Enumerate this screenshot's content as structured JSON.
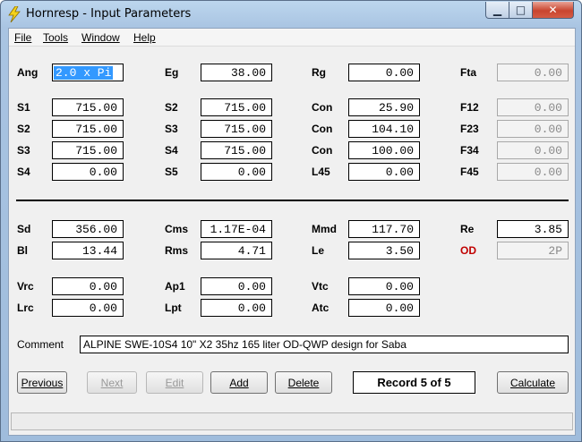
{
  "window": {
    "title": "Hornresp - Input Parameters"
  },
  "menu": [
    "File",
    "Tools",
    "Window",
    "Help"
  ],
  "rows1": [
    [
      {
        "label": "Ang",
        "value": "2.0 x Pi",
        "selected": true
      },
      {
        "label": "Eg",
        "value": "38.00"
      },
      {
        "label": "Rg",
        "value": "0.00"
      },
      {
        "label": "Fta",
        "value": "0.00",
        "disabled": true
      }
    ],
    [
      {
        "label": "S1",
        "value": "715.00"
      },
      {
        "label": "S2",
        "value": "715.00"
      },
      {
        "label": "Con",
        "value": "25.90"
      },
      {
        "label": "F12",
        "value": "0.00",
        "disabled": true
      }
    ],
    [
      {
        "label": "S2",
        "value": "715.00"
      },
      {
        "label": "S3",
        "value": "715.00"
      },
      {
        "label": "Con",
        "value": "104.10"
      },
      {
        "label": "F23",
        "value": "0.00",
        "disabled": true
      }
    ],
    [
      {
        "label": "S3",
        "value": "715.00"
      },
      {
        "label": "S4",
        "value": "715.00"
      },
      {
        "label": "Con",
        "value": "100.00"
      },
      {
        "label": "F34",
        "value": "0.00",
        "disabled": true
      }
    ],
    [
      {
        "label": "S4",
        "value": "0.00"
      },
      {
        "label": "S5",
        "value": "0.00"
      },
      {
        "label": "L45",
        "value": "0.00"
      },
      {
        "label": "F45",
        "value": "0.00",
        "disabled": true
      }
    ]
  ],
  "rows2": [
    [
      {
        "label": "Sd",
        "value": "356.00"
      },
      {
        "label": "Cms",
        "value": "1.17E-04"
      },
      {
        "label": "Mmd",
        "value": "117.70"
      },
      {
        "label": "Re",
        "value": "3.85"
      }
    ],
    [
      {
        "label": "Bl",
        "value": "13.44"
      },
      {
        "label": "Rms",
        "value": "4.71"
      },
      {
        "label": "Le",
        "value": "3.50"
      },
      {
        "label": "OD",
        "value": "2P",
        "red": true,
        "disabled": true
      }
    ],
    [
      {
        "label": "Vrc",
        "value": "0.00"
      },
      {
        "label": "Ap1",
        "value": "0.00"
      },
      {
        "label": "Vtc",
        "value": "0.00"
      }
    ],
    [
      {
        "label": "Lrc",
        "value": "0.00"
      },
      {
        "label": "Lpt",
        "value": "0.00"
      },
      {
        "label": "Atc",
        "value": "0.00"
      }
    ]
  ],
  "comment": {
    "label": "Comment",
    "value": "ALPINE SWE-10S4 10\" X2 35hz 165 liter OD-QWP design for Saba"
  },
  "buttons": [
    {
      "label": "Previous",
      "disabled": false
    },
    {
      "label": "Next",
      "disabled": true
    },
    {
      "label": "Edit",
      "disabled": true
    },
    {
      "label": "Add",
      "disabled": false
    },
    {
      "label": "Delete",
      "disabled": false
    },
    {
      "label": "Calculate",
      "disabled": false
    }
  ],
  "record": "Record 5 of 5"
}
